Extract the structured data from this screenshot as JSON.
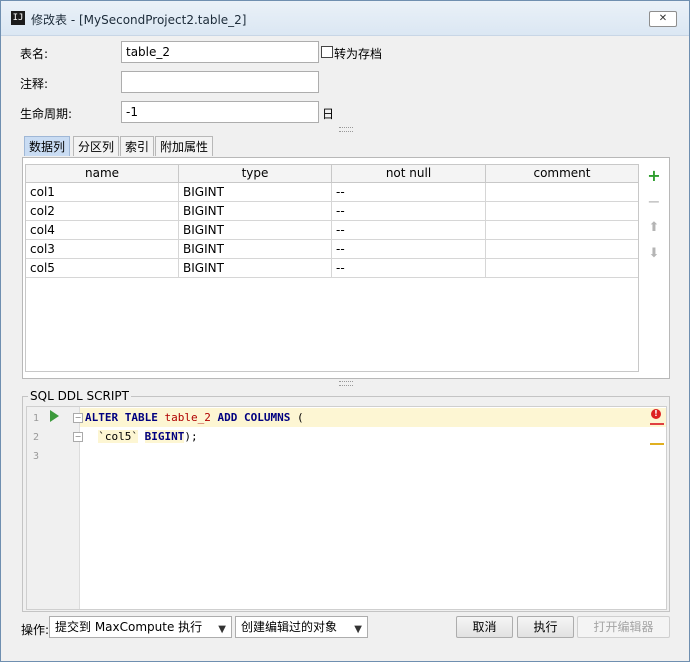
{
  "window": {
    "title": "修改表 - [MySecondProject2.table_2]",
    "close_glyph": "✕",
    "app_icon_text": "IJ"
  },
  "form": {
    "table_name_label": "表名:",
    "table_name_value": "table_2",
    "to_archive_label": "转为存档",
    "comment_label": "注释:",
    "comment_value": "",
    "lifecycle_label": "生命周期:",
    "lifecycle_value": "-1",
    "lifecycle_unit": "日"
  },
  "tabs": [
    {
      "label": "数据列",
      "active": true
    },
    {
      "label": "分区列",
      "active": false
    },
    {
      "label": "索引",
      "active": false
    },
    {
      "label": "附加属性",
      "active": false
    }
  ],
  "columns_table": {
    "headers": [
      "name",
      "type",
      "not null",
      "comment"
    ],
    "rows": [
      [
        "col1",
        "BIGINT",
        "--",
        ""
      ],
      [
        "col2",
        "BIGINT",
        "--",
        ""
      ],
      [
        "col4",
        "BIGINT",
        "--",
        ""
      ],
      [
        "col3",
        "BIGINT",
        "--",
        ""
      ],
      [
        "col5",
        "BIGINT",
        "--",
        ""
      ]
    ]
  },
  "side_tools": {
    "add": "+",
    "remove": "−",
    "up": "⬆",
    "down": "⬇"
  },
  "ddl": {
    "label": "SQL DDL SCRIPT",
    "line_numbers": [
      "1",
      "2",
      "3"
    ],
    "line1": {
      "kw1": "ALTER TABLE",
      "table": "table_2",
      "kw2": "ADD COLUMNS",
      "rest": " ("
    },
    "line2": {
      "col": "`col5`",
      "type": "BIGINT",
      "end": ");"
    },
    "error_glyph": "!",
    "colors": {
      "keyword": "#000080",
      "table_name": "#b00000",
      "highlight": "#fdf6d3"
    }
  },
  "footer": {
    "action_label": "操作:",
    "action_combo": "提交到 MaxCompute 执行",
    "object_combo": "创建编辑过的对象",
    "cancel_button": "取消",
    "execute_button": "执行",
    "open_editor_button": "打开编辑器"
  }
}
